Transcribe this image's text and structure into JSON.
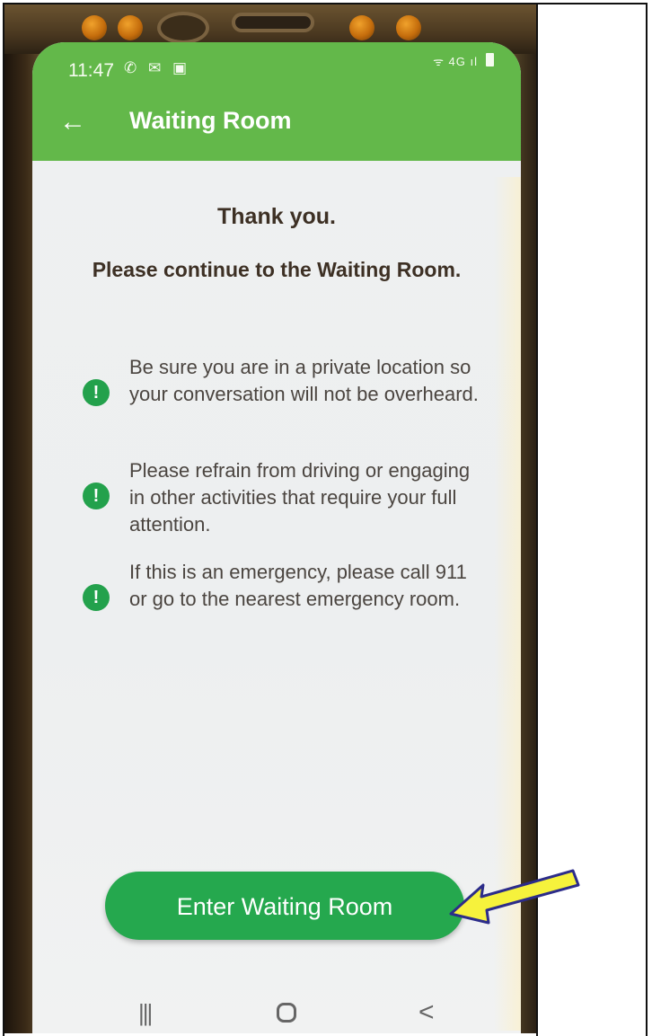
{
  "status_bar": {
    "time": "11:47",
    "notification_icons": [
      "missed-call-icon",
      "message-icon",
      "gallery-icon"
    ],
    "signal_text": "ᯤ 4G ıl",
    "battery_icon": "battery-icon"
  },
  "app_bar": {
    "back_icon": "←",
    "title": "Waiting Room",
    "color": "#63b84a"
  },
  "main": {
    "heading": "Thank you.",
    "subheading": "Please continue to the Waiting Room.",
    "notices": [
      {
        "icon": "!",
        "text": "Be sure you are in a private location so your conversation will not be overheard."
      },
      {
        "icon": "!",
        "text": "Please refrain from driving or engaging in other activities that require your full attention."
      },
      {
        "icon": "!",
        "text": "If this is an emergency, please call 911 or go to the nearest emergency room."
      }
    ],
    "enter_button_label": "Enter Waiting Room",
    "button_color": "#25a84e"
  },
  "nav_bar": {
    "recents_icon": "|||",
    "back_icon": "<"
  },
  "annotation": {
    "arrow_color": "#f6f23c"
  }
}
